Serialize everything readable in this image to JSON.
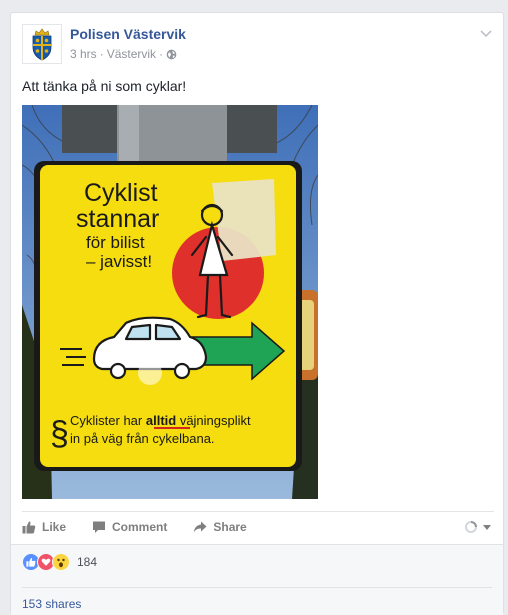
{
  "post": {
    "page_name": "Polisen Västervik",
    "time": "3 hrs",
    "location": "Västervik",
    "separator": "·",
    "text": "Att tänka på ni som cyklar!",
    "photo_sign": {
      "line1": "Cyklist",
      "line2": "stannar",
      "line3": "för bilist",
      "line4": "– javisst!",
      "footnote_symbol": "§",
      "footnote_line1_a": "Cyklister har ",
      "footnote_line1_b": "alltid",
      "footnote_line1_c": " väjningsplikt",
      "footnote_line2": "in på väg från cykelbana."
    }
  },
  "actions": {
    "like": "Like",
    "comment": "Comment",
    "share": "Share"
  },
  "footer": {
    "reaction_count": "184",
    "shares": "153 shares"
  },
  "colors": {
    "link": "#365899",
    "sign_yellow": "#f5dd10",
    "red_circle": "#e0302b",
    "arrow_green": "#1fa354"
  }
}
